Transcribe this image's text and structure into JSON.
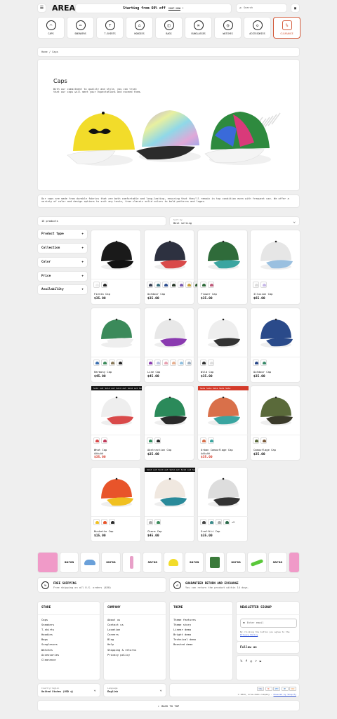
{
  "header": {
    "logo": "AREA",
    "promo": "Starting from 60% off",
    "shop_now": "SHOP NOW",
    "search_placeholder": "Search"
  },
  "categories": [
    "CAPS",
    "SNEAKERS",
    "T-SHIRTS",
    "HOODIES",
    "BAGS",
    "SUNGLASSES",
    "WATCHES",
    "ACCESSORIES",
    "CLEARANCE"
  ],
  "breadcrumb": "Home / Caps",
  "hero": {
    "title": "Caps",
    "text": "With our commitment to quality and style, you can trust that our caps will meet your expectations and exceed them."
  },
  "description": "Our caps are made from durable fabrics that are both comfortable and long-lasting, ensuring that they'll remain in top condition even with frequent use. We offer a variety of color and design options to suit any taste, from classic solid colors to bold patterns and logos.",
  "toolbar": {
    "count": "15 products",
    "sort_label": "Sort by",
    "sort_value": "Best selling"
  },
  "filters": [
    "Product type",
    "Collection",
    "Color",
    "Price",
    "Availability"
  ],
  "products": [
    {
      "name": "Fiesta Cap",
      "price": "$35.00",
      "colors": {
        "body": "#1a1a1a",
        "brim": "#111"
      },
      "swatches": [
        "#eee",
        "#222"
      ]
    },
    {
      "name": "Outdoor Cap",
      "price": "$35.00",
      "colors": {
        "body": "#2d3140",
        "brim": "#d94a4a"
      },
      "swatches": [
        "#3a3f52",
        "#356a7a",
        "#2e4e8f",
        "#2b3a2b",
        "#7a5bb0",
        "#c9a23a",
        "#2f5a2f"
      ]
    },
    {
      "name": "Flower Cap",
      "price": "$35.00",
      "colors": {
        "body": "#2f6b3a",
        "brim": "#3aa5a0"
      },
      "swatches": [
        "#2f6b3a",
        "#c05a7a"
      ]
    },
    {
      "name": "Illusion Cap",
      "price": "$65.00",
      "colors": {
        "body": "#e6e6e6",
        "brim": "#9ac0e0"
      },
      "swatches": [
        "#ddd",
        "#c7b8e8"
      ]
    },
    {
      "name": "Harmony Cap",
      "price": "$45.00",
      "colors": {
        "body": "#3b8a5a",
        "brim": "#eeeeee"
      },
      "swatches": [
        "#3b6fb0",
        "#3b8a5a",
        "#8a7a5a",
        "#222"
      ]
    },
    {
      "name": "Line Cap",
      "price": "$45.00",
      "colors": {
        "body": "#e8e8e8",
        "brim": "#8a3ab0"
      },
      "swatches": [
        "#8a3ab0",
        "#b9c0e0",
        "#e8a0b0",
        "#e8b090",
        "#90c0e0",
        "#a0b0c0"
      ]
    },
    {
      "name": "Wild Cap",
      "price": "$35.00",
      "colors": {
        "body": "#eeeeee",
        "brim": "#333333"
      },
      "swatches": [
        "#333",
        "#ddd"
      ]
    },
    {
      "name": "Outdoor Cap",
      "price": "$35.00",
      "colors": {
        "body": "#2a4a8a",
        "brim": "#2a4a8a"
      },
      "swatches": [
        "#2a4a8a",
        "#3a8a6a"
      ]
    },
    {
      "name": "What Cap",
      "old": "$50.00",
      "sale": "$35.00",
      "banner": "Sold out",
      "colors": {
        "body": "#eeeeee",
        "brim": "#d94a4a"
      },
      "swatches": [
        "#d94a4a",
        "#c03a5a"
      ]
    },
    {
      "name": "Abstraction Cap",
      "price": "$25.00",
      "colors": {
        "body": "#2b8a5a",
        "brim": "#2a2a2a"
      },
      "swatches": [
        "#2b8a5a",
        "#2a2a2a"
      ]
    },
    {
      "name": "Urban Camouflage Cap",
      "old": "$45.00",
      "sale": "$35.00",
      "banner": "Sale",
      "colors": {
        "body": "#d9704a",
        "brim": "#3aa5a0"
      },
      "swatches": [
        "#d9704a",
        "#3aa5a0"
      ]
    },
    {
      "name": "Camouflage Cap",
      "price": "$35.00",
      "colors": {
        "body": "#5a6a3a",
        "brim": "#3a3a2a"
      },
      "swatches": [
        "#5a6a3a",
        "#7a5a3a"
      ]
    },
    {
      "name": "Bushette Cap",
      "price": "$15.00",
      "colors": {
        "body": "#e8542a",
        "brim": "#f0c020"
      },
      "swatches": [
        "#f0c020",
        "#e8542a",
        "#2a2a2a"
      ]
    },
    {
      "name": "Charm Cap",
      "price": "$45.00",
      "banner": "Sold out",
      "colors": {
        "body": "#f0e8e0",
        "brim": "#2a8a9a"
      },
      "swatches": [
        "#aaa",
        "#3a8a5a"
      ]
    },
    {
      "name": "Graffiti Cap",
      "price": "$35.00",
      "colors": {
        "body": "#dddddd",
        "brim": "#333333"
      },
      "swatches": [
        "#444",
        "#3a8a8a",
        "#aaa",
        "#2a6a4a"
      ],
      "more": "+2"
    }
  ],
  "strip_logo": "aarea",
  "features": [
    {
      "title": "FREE SHIPPING",
      "text": "Free shipping on all U.S. orders ($50)"
    },
    {
      "title": "GUARANTEED RETURN AND EXCHANGE",
      "text": "You can return the product within 14 days."
    }
  ],
  "footer": {
    "store": {
      "title": "STORE",
      "items": [
        "Caps",
        "Sneakers",
        "T-shirts",
        "Hoodies",
        "Bags",
        "Sunglasses",
        "Watches",
        "Accessories",
        "Clearance"
      ]
    },
    "company": {
      "title": "COMPANY",
      "items": [
        "About us",
        "Contact us",
        "Location",
        "Careers",
        "Blog",
        "Help",
        "Shipping & returns",
        "Privacy policy"
      ]
    },
    "theme": {
      "title": "THEME",
      "items": [
        "Theme features",
        "Theme story",
        "Linear demo",
        "Bright demo",
        "Technical demo",
        "Boosted demo"
      ]
    },
    "newsletter": {
      "title": "NEWSLETTER SIGNUP",
      "placeholder": "Enter email",
      "note": "By clicking the button you agree to the",
      "policy": "Privacy Policy"
    },
    "follow": "Follow us",
    "country_label": "Country/region",
    "country": "United States (USD $)",
    "language_label": "Language",
    "language": "English",
    "copyright": "© 2024, area-demo-company",
    "powered": "Powered by Shopify",
    "back": "BACK TO TOP"
  },
  "payments": [
    "VISA",
    "MC",
    "AMEX",
    "PP",
    "DISC"
  ]
}
